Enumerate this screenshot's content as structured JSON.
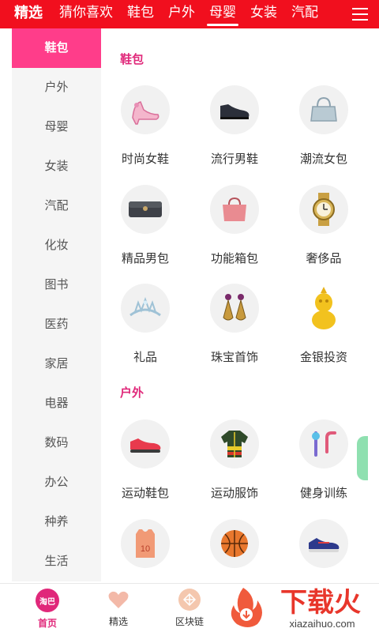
{
  "topbar": {
    "tabs": [
      {
        "label": "精选"
      },
      {
        "label": "猜你喜欢"
      },
      {
        "label": "鞋包"
      },
      {
        "label": "户外"
      },
      {
        "label": "母婴"
      },
      {
        "label": "女装"
      },
      {
        "label": "汽配"
      }
    ],
    "active_index": 4,
    "menu_icon": "hamburger-menu-icon",
    "color": "#f10f1e"
  },
  "sidebar": {
    "items": [
      {
        "label": "鞋包"
      },
      {
        "label": "户外"
      },
      {
        "label": "母婴"
      },
      {
        "label": "女装"
      },
      {
        "label": "汽配"
      },
      {
        "label": "化妆"
      },
      {
        "label": "图书"
      },
      {
        "label": "医药"
      },
      {
        "label": "家居"
      },
      {
        "label": "电器"
      },
      {
        "label": "数码"
      },
      {
        "label": "办公"
      },
      {
        "label": "种养"
      },
      {
        "label": "生活"
      }
    ],
    "active_index": 0,
    "active_color": "#ff3d8a"
  },
  "sections": [
    {
      "title": "鞋包",
      "items": [
        {
          "label": "时尚女鞋",
          "icon": "high-heel-icon"
        },
        {
          "label": "流行男鞋",
          "icon": "mens-shoe-icon"
        },
        {
          "label": "潮流女包",
          "icon": "handbag-icon"
        },
        {
          "label": "精品男包",
          "icon": "clutch-icon"
        },
        {
          "label": "功能箱包",
          "icon": "travel-bag-icon"
        },
        {
          "label": "奢侈品",
          "icon": "watch-icon"
        },
        {
          "label": "礼品",
          "icon": "tiara-icon"
        },
        {
          "label": "珠宝首饰",
          "icon": "earrings-icon"
        },
        {
          "label": "金银投资",
          "icon": "gold-figurine-icon"
        }
      ]
    },
    {
      "title": "户外",
      "items": [
        {
          "label": "运动鞋包",
          "icon": "sneaker-icon"
        },
        {
          "label": "运动服饰",
          "icon": "sport-jacket-icon"
        },
        {
          "label": "健身训练",
          "icon": "fitness-equipment-icon"
        },
        {
          "label": "",
          "icon": "jersey-icon"
        },
        {
          "label": "",
          "icon": "basketball-icon"
        },
        {
          "label": "",
          "icon": "running-shoe-icon"
        }
      ]
    }
  ],
  "jersey_number": "10",
  "tabbar": {
    "items": [
      {
        "label": "首页",
        "icon": "taoba-home-icon",
        "badge": "淘巴"
      },
      {
        "label": "精选",
        "icon": "heart-icon"
      },
      {
        "label": "区块链",
        "icon": "blockchain-icon"
      }
    ],
    "active_index": 0
  },
  "watermark": {
    "title": "下载火",
    "url": "xiazaihuo.com"
  }
}
